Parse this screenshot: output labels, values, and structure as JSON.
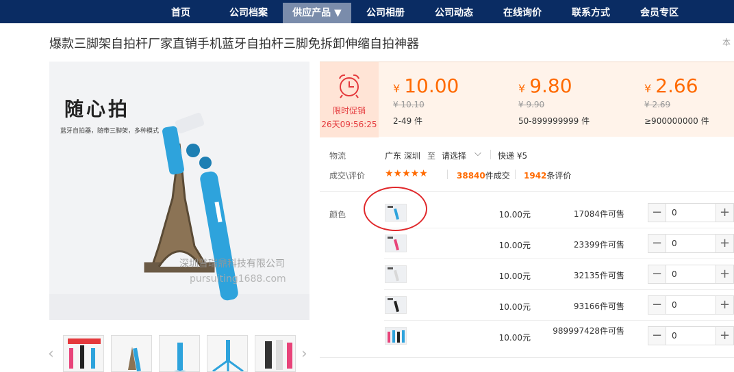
{
  "nav": {
    "items": [
      {
        "label": "首页",
        "active": false
      },
      {
        "label": "公司档案",
        "active": false
      },
      {
        "label": "供应产品 ▼",
        "active": true
      },
      {
        "label": "公司相册",
        "active": false
      },
      {
        "label": "公司动态",
        "active": false
      },
      {
        "label": "在线询价",
        "active": false
      },
      {
        "label": "联系方式",
        "active": false
      },
      {
        "label": "会员专区",
        "active": false
      }
    ]
  },
  "product": {
    "title": "爆款三脚架自拍杆厂家直销手机蓝牙自拍杆三脚免拆卸伸缩自拍神器",
    "title_right_fragment": "本"
  },
  "gallery": {
    "slogan": "随心拍",
    "subslogan": "蓝牙自拍器，随带三脚架，多种模式",
    "watermark_company": "深圳普瑞鼎科技有限公司",
    "watermark_url": "pursuiting1688.com"
  },
  "promo": {
    "icon": "alarm-clock-icon",
    "label": "限时促销",
    "timer": "26天09:56:25"
  },
  "price_tiers": [
    {
      "currency": "¥",
      "price": "10.00",
      "original": "¥ 10.10",
      "range": "2-49 件"
    },
    {
      "currency": "¥",
      "price": "9.80",
      "original": "¥ 9.90",
      "range": "50-899999999 件"
    },
    {
      "currency": "¥",
      "price": "2.66",
      "original": "¥ 2.69",
      "range": "≥900000000 件"
    }
  ],
  "logistics": {
    "label": "物流",
    "from": "广东 深圳",
    "to_word": "至",
    "destination": "请选择",
    "shipping": "快递 ¥5"
  },
  "reviews": {
    "label": "成交\\评价",
    "stars": "★★★★★",
    "rating": 5,
    "deals_count": "38840",
    "deals_suffix": "件成交",
    "review_count": "1942",
    "review_suffix": "条评价"
  },
  "sku": {
    "label": "颜色",
    "rows": [
      {
        "price": "10.00元",
        "stock": "17084件可售",
        "qty": "0"
      },
      {
        "price": "10.00元",
        "stock": "23399件可售",
        "qty": "0"
      },
      {
        "price": "10.00元",
        "stock": "32135件可售",
        "qty": "0"
      },
      {
        "price": "10.00元",
        "stock": "93166件可售",
        "qty": "0"
      },
      {
        "price": "10.00元",
        "stock": "989997428件可售",
        "qty": "0"
      }
    ]
  },
  "colors": {
    "nav_bg": "#0a2c63",
    "nav_active": "#7a8cab",
    "price_orange": "#ff6a00",
    "promo_red": "#e4393c",
    "annotation_red": "#e0282b"
  }
}
